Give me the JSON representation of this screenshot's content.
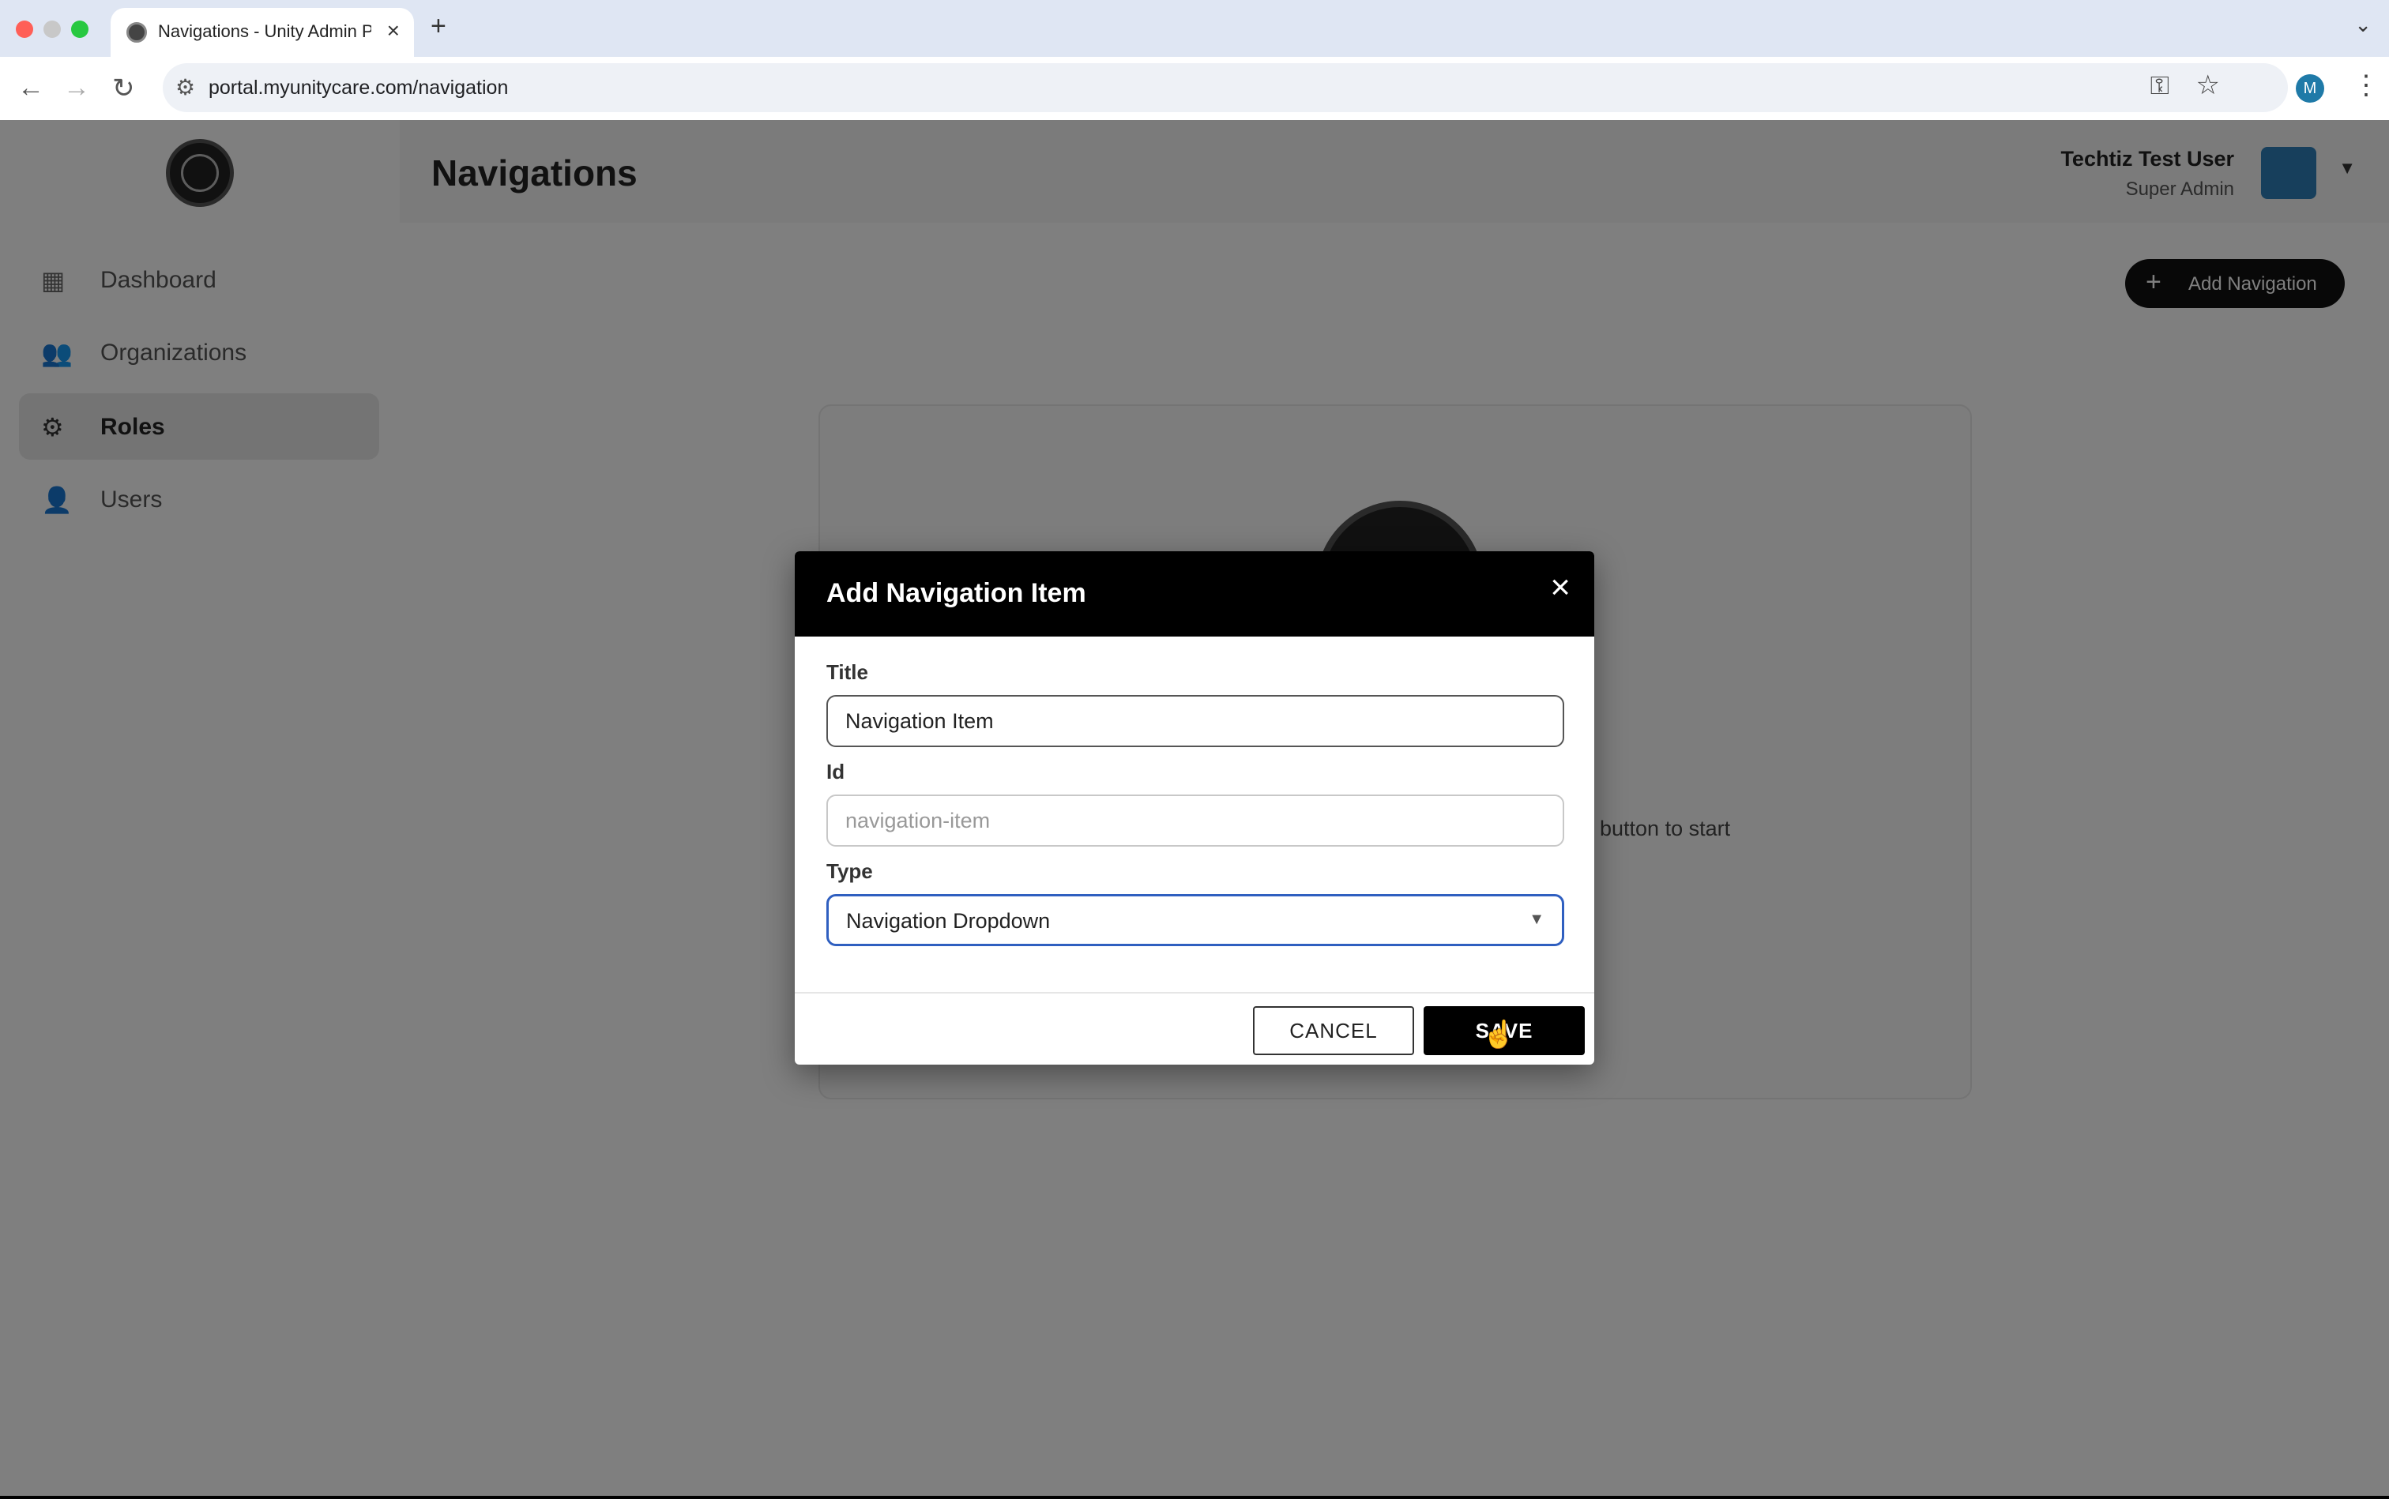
{
  "browser": {
    "tab_title": "Navigations - Unity Admin Portal",
    "new_tab_symbol": "+",
    "url": "portal.myunitycare.com/navigation",
    "profile_initial": "M",
    "icons": [
      "back-icon",
      "forward-icon",
      "reload-icon",
      "site-info-icon",
      "password-key-icon",
      "bookmark-star-icon",
      "menu-kebab-icon"
    ]
  },
  "sidebar": {
    "items": [
      {
        "label": "Dashboard",
        "icon": "dashboard-icon",
        "active": false
      },
      {
        "label": "Organizations",
        "icon": "organizations-icon",
        "active": false
      },
      {
        "label": "Roles",
        "icon": "roles-icon",
        "active": true
      },
      {
        "label": "Users",
        "icon": "users-icon",
        "active": false
      }
    ]
  },
  "header": {
    "title": "Navigations",
    "user_name": "Techtiz Test User",
    "user_role": "Super Admin"
  },
  "main": {
    "add_button_label": "Add Navigation",
    "empty_text": "button to start"
  },
  "modal": {
    "title": "Add Navigation Item",
    "fields": {
      "title_label": "Title",
      "title_value": "Navigation Item",
      "id_label": "Id",
      "id_placeholder": "navigation-item",
      "type_label": "Type",
      "type_value": "Navigation Dropdown"
    },
    "cancel_label": "CANCEL",
    "save_label": "SAVE"
  },
  "colors": {
    "accent_primary": "#000000",
    "select_focus": "#2f5fc0",
    "overlay": "rgba(0,0,0,0.5)"
  }
}
